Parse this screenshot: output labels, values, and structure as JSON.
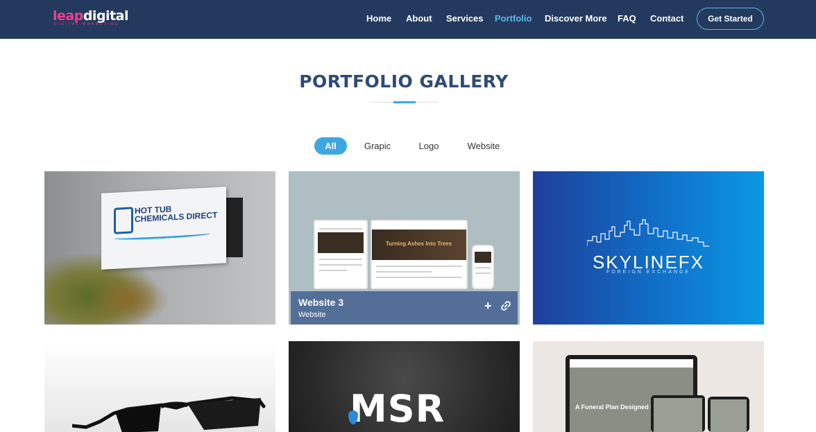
{
  "header": {
    "logo": {
      "main_a": "leap",
      "main_b": "digital",
      "sub": "DIGITAL MARKETING"
    },
    "nav": [
      {
        "label": "Home",
        "active": false
      },
      {
        "label": "About",
        "active": false
      },
      {
        "label": "Services",
        "active": false
      },
      {
        "label": "Portfolio",
        "active": true
      },
      {
        "label": "Discover More",
        "active": false
      },
      {
        "label": "FAQ",
        "active": false
      },
      {
        "label": "Contact",
        "active": false
      }
    ],
    "cta_label": "Get Started"
  },
  "section": {
    "title": "PORTFOLIO GALLERY"
  },
  "filters": [
    {
      "label": "All",
      "active": true
    },
    {
      "label": "Grapic",
      "active": false
    },
    {
      "label": "Logo",
      "active": false
    },
    {
      "label": "Website",
      "active": false
    }
  ],
  "gallery": {
    "items": [
      {
        "image": "hot-tub-chemicals-direct-sign",
        "sign_text": "HOT TUB CHEMICALS DIRECT"
      },
      {
        "image": "turning-ashes-into-trees-website-mockup",
        "overlay_title": "Website 3",
        "overlay_category": "Website",
        "screen_headline": "Turning Ashes Into Trees"
      },
      {
        "image": "skylinefx-logo",
        "logo_text": "SKYLINEFX",
        "logo_sub": "FOREIGN EXCHANGE"
      },
      {
        "image": "ray-ban-sunglasses"
      },
      {
        "image": "msr-logo",
        "logo_text": "MSR"
      },
      {
        "image": "funeral-plan-website-mockup",
        "screen_headline": "A Funeral Plan Designed For You"
      }
    ]
  },
  "colors": {
    "header_bg": "#233a5e",
    "accent": "#3fa6e2",
    "title": "#2e4a74",
    "logo_pink": "#e8408f"
  }
}
